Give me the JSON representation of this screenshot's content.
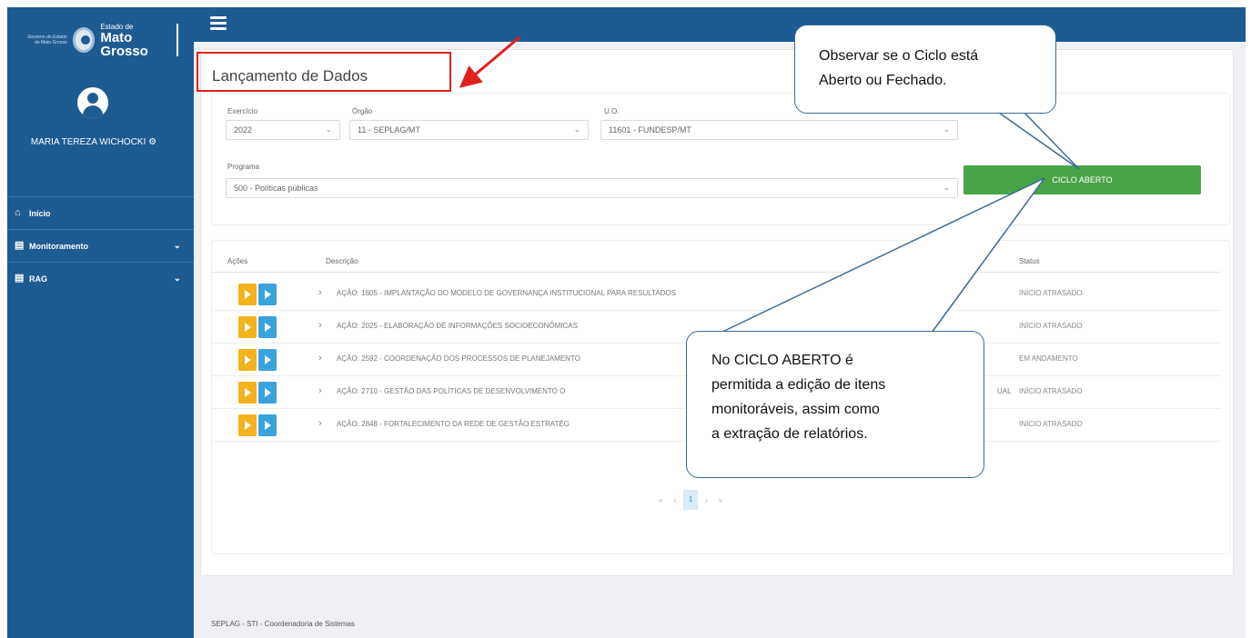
{
  "brand": {
    "gov_small": "Governo do Estado de Mato Grosso",
    "state_small": "Estado de",
    "state_big": "Mato Grosso"
  },
  "user": {
    "name": "MARIA TEREZA WICHOCKI"
  },
  "sidebar": {
    "items": [
      {
        "label": "Início",
        "icon": "home-icon"
      },
      {
        "label": "Monitoramento",
        "icon": "building-icon",
        "expandable": true
      },
      {
        "label": "RAG",
        "icon": "building-icon",
        "expandable": true
      }
    ]
  },
  "page": {
    "title": "Lançamento de Dados"
  },
  "filters": {
    "exercicio": {
      "label": "Exercício",
      "value": "2022"
    },
    "orgao": {
      "label": "Órgão",
      "value": "11 - SEPLAG/MT"
    },
    "uo": {
      "label": "U.O.",
      "value": "11601 - FUNDESP/MT"
    },
    "programa": {
      "label": "Programa",
      "value": "500 - Políticas públicas"
    }
  },
  "cycle_button": {
    "label": "CICLO ABERTO",
    "color": "#48a547"
  },
  "table": {
    "headers": {
      "acoes": "Ações",
      "descricao": "Descrição",
      "status": "Status"
    },
    "rows": [
      {
        "descricao": "AÇÃO: 1605 - IMPLANTAÇÃO DO MODELO DE GOVERNANÇA INSTITUCIONAL PARA RESULTADOS",
        "status": "INÍCIO ATRASADO"
      },
      {
        "descricao": "AÇÃO: 2025 - ELABORAÇÃO DE INFORMAÇÕES SOCIOECONÔMICAS",
        "status": "INÍCIO ATRASADO"
      },
      {
        "descricao": "AÇÃO: 2592 - COORDENAÇÃO DOS PROCESSOS DE PLANEJAMENTO",
        "status": "EM ANDAMENTO"
      },
      {
        "descricao": "AÇÃO: 2710 - GESTÃO DAS POLÍTICAS DE DESENVOLVIMENTO O",
        "desc_tail": "UAL",
        "status": "INÍCIO ATRASADO"
      },
      {
        "descricao": "AÇÃO: 2848 - FORTALECIMENTO DA REDE DE GESTÃO ESTRATÉG",
        "status": "INÍCIO ATRASADO"
      }
    ]
  },
  "pagination": {
    "first": "«",
    "prev": "‹",
    "current": "1",
    "next": "›",
    "last": "»"
  },
  "footer": {
    "text": "SEPLAG - STI - Coordenadoria de Sistemas"
  },
  "annotations": {
    "callout_top": [
      "Observar se o Ciclo está",
      "Aberto ou Fechado."
    ],
    "callout_bottom": [
      "No CICLO ABERTO é",
      "permitida a edição de itens",
      "monitoráveis, assim como",
      "a extração de relatórios."
    ],
    "highlight_color": "#e0211f"
  }
}
